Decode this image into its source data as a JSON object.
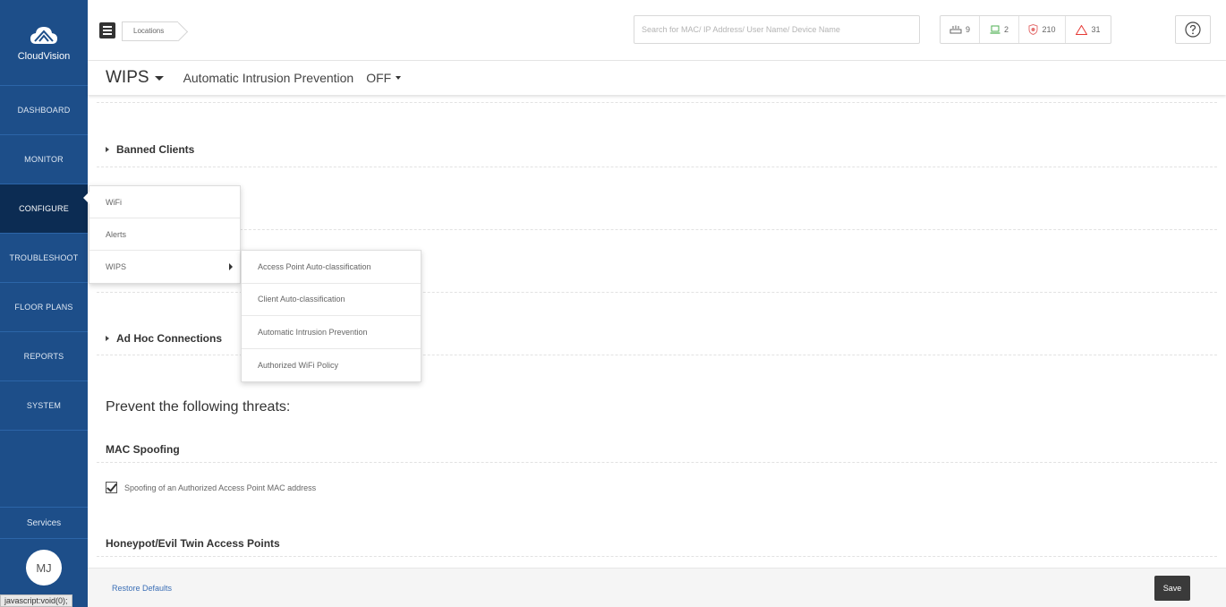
{
  "app": {
    "name": "CloudVision"
  },
  "sidebar": {
    "items": [
      {
        "label": "DASHBOARD"
      },
      {
        "label": "MONITOR"
      },
      {
        "label": "CONFIGURE"
      },
      {
        "label": "TROUBLESHOOT"
      },
      {
        "label": "FLOOR PLANS"
      },
      {
        "label": "REPORTS"
      },
      {
        "label": "SYSTEM"
      }
    ],
    "active": "CONFIGURE",
    "services_label": "Services",
    "user_initials": "MJ",
    "status_url": "javascript:void(0);"
  },
  "topbar": {
    "breadcrumb": "Locations",
    "search_placeholder": "Search for MAC/ IP Address/ User Name/ Device Name",
    "badges": [
      {
        "icon": "access-point-icon",
        "count": "9",
        "color": "#666666"
      },
      {
        "icon": "laptop-icon",
        "count": "2",
        "color": "#4caf50"
      },
      {
        "icon": "shield-icon",
        "count": "210",
        "color": "#e57373"
      },
      {
        "icon": "warning-icon",
        "count": "31",
        "color": "#e53935"
      }
    ],
    "help_icon": "question-circle-icon"
  },
  "subheader": {
    "title": "WIPS",
    "feature_label": "Automatic Intrusion Prevention",
    "feature_state": "OFF"
  },
  "content": {
    "sections": [
      {
        "label": "Banned Clients"
      },
      {
        "label": "Ad Hoc Connections"
      }
    ],
    "heading": "Prevent the following threats:",
    "groups": [
      {
        "title": "MAC Spoofing",
        "options": [
          {
            "label": "Spoofing of an Authorized Access Point MAC address",
            "checked": true
          }
        ]
      },
      {
        "title": "Honeypot/Evil Twin Access Points"
      }
    ]
  },
  "footer": {
    "restore_label": "Restore Defaults",
    "save_label": "Save"
  },
  "configure_menu": {
    "items": [
      {
        "label": "WiFi"
      },
      {
        "label": "Alerts"
      },
      {
        "label": "WIPS"
      }
    ],
    "wips_submenu": [
      {
        "label": "Access Point Auto-classification"
      },
      {
        "label": "Client Auto-classification"
      },
      {
        "label": "Automatic Intrusion Prevention"
      },
      {
        "label": "Authorized WiFi Policy"
      }
    ]
  },
  "colors": {
    "sidebar_bg": "#1d4e89",
    "sidebar_active": "#0c2c53",
    "link": "#3b6fb6",
    "save_button": "#3a3a3a"
  }
}
